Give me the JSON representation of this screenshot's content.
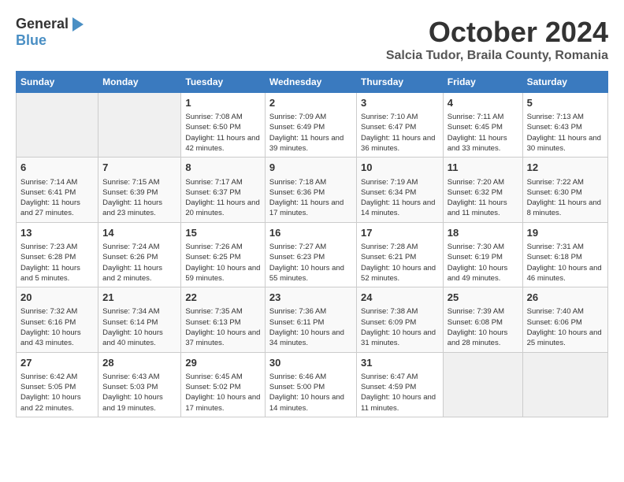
{
  "logo": {
    "general": "General",
    "blue": "Blue"
  },
  "title": "October 2024",
  "location": "Salcia Tudor, Braila County, Romania",
  "days_of_week": [
    "Sunday",
    "Monday",
    "Tuesday",
    "Wednesday",
    "Thursday",
    "Friday",
    "Saturday"
  ],
  "weeks": [
    [
      {
        "day": "",
        "empty": true
      },
      {
        "day": "",
        "empty": true
      },
      {
        "day": "1",
        "sunrise": "Sunrise: 7:08 AM",
        "sunset": "Sunset: 6:50 PM",
        "daylight": "Daylight: 11 hours and 42 minutes."
      },
      {
        "day": "2",
        "sunrise": "Sunrise: 7:09 AM",
        "sunset": "Sunset: 6:49 PM",
        "daylight": "Daylight: 11 hours and 39 minutes."
      },
      {
        "day": "3",
        "sunrise": "Sunrise: 7:10 AM",
        "sunset": "Sunset: 6:47 PM",
        "daylight": "Daylight: 11 hours and 36 minutes."
      },
      {
        "day": "4",
        "sunrise": "Sunrise: 7:11 AM",
        "sunset": "Sunset: 6:45 PM",
        "daylight": "Daylight: 11 hours and 33 minutes."
      },
      {
        "day": "5",
        "sunrise": "Sunrise: 7:13 AM",
        "sunset": "Sunset: 6:43 PM",
        "daylight": "Daylight: 11 hours and 30 minutes."
      }
    ],
    [
      {
        "day": "6",
        "sunrise": "Sunrise: 7:14 AM",
        "sunset": "Sunset: 6:41 PM",
        "daylight": "Daylight: 11 hours and 27 minutes."
      },
      {
        "day": "7",
        "sunrise": "Sunrise: 7:15 AM",
        "sunset": "Sunset: 6:39 PM",
        "daylight": "Daylight: 11 hours and 23 minutes."
      },
      {
        "day": "8",
        "sunrise": "Sunrise: 7:17 AM",
        "sunset": "Sunset: 6:37 PM",
        "daylight": "Daylight: 11 hours and 20 minutes."
      },
      {
        "day": "9",
        "sunrise": "Sunrise: 7:18 AM",
        "sunset": "Sunset: 6:36 PM",
        "daylight": "Daylight: 11 hours and 17 minutes."
      },
      {
        "day": "10",
        "sunrise": "Sunrise: 7:19 AM",
        "sunset": "Sunset: 6:34 PM",
        "daylight": "Daylight: 11 hours and 14 minutes."
      },
      {
        "day": "11",
        "sunrise": "Sunrise: 7:20 AM",
        "sunset": "Sunset: 6:32 PM",
        "daylight": "Daylight: 11 hours and 11 minutes."
      },
      {
        "day": "12",
        "sunrise": "Sunrise: 7:22 AM",
        "sunset": "Sunset: 6:30 PM",
        "daylight": "Daylight: 11 hours and 8 minutes."
      }
    ],
    [
      {
        "day": "13",
        "sunrise": "Sunrise: 7:23 AM",
        "sunset": "Sunset: 6:28 PM",
        "daylight": "Daylight: 11 hours and 5 minutes."
      },
      {
        "day": "14",
        "sunrise": "Sunrise: 7:24 AM",
        "sunset": "Sunset: 6:26 PM",
        "daylight": "Daylight: 11 hours and 2 minutes."
      },
      {
        "day": "15",
        "sunrise": "Sunrise: 7:26 AM",
        "sunset": "Sunset: 6:25 PM",
        "daylight": "Daylight: 10 hours and 59 minutes."
      },
      {
        "day": "16",
        "sunrise": "Sunrise: 7:27 AM",
        "sunset": "Sunset: 6:23 PM",
        "daylight": "Daylight: 10 hours and 55 minutes."
      },
      {
        "day": "17",
        "sunrise": "Sunrise: 7:28 AM",
        "sunset": "Sunset: 6:21 PM",
        "daylight": "Daylight: 10 hours and 52 minutes."
      },
      {
        "day": "18",
        "sunrise": "Sunrise: 7:30 AM",
        "sunset": "Sunset: 6:19 PM",
        "daylight": "Daylight: 10 hours and 49 minutes."
      },
      {
        "day": "19",
        "sunrise": "Sunrise: 7:31 AM",
        "sunset": "Sunset: 6:18 PM",
        "daylight": "Daylight: 10 hours and 46 minutes."
      }
    ],
    [
      {
        "day": "20",
        "sunrise": "Sunrise: 7:32 AM",
        "sunset": "Sunset: 6:16 PM",
        "daylight": "Daylight: 10 hours and 43 minutes."
      },
      {
        "day": "21",
        "sunrise": "Sunrise: 7:34 AM",
        "sunset": "Sunset: 6:14 PM",
        "daylight": "Daylight: 10 hours and 40 minutes."
      },
      {
        "day": "22",
        "sunrise": "Sunrise: 7:35 AM",
        "sunset": "Sunset: 6:13 PM",
        "daylight": "Daylight: 10 hours and 37 minutes."
      },
      {
        "day": "23",
        "sunrise": "Sunrise: 7:36 AM",
        "sunset": "Sunset: 6:11 PM",
        "daylight": "Daylight: 10 hours and 34 minutes."
      },
      {
        "day": "24",
        "sunrise": "Sunrise: 7:38 AM",
        "sunset": "Sunset: 6:09 PM",
        "daylight": "Daylight: 10 hours and 31 minutes."
      },
      {
        "day": "25",
        "sunrise": "Sunrise: 7:39 AM",
        "sunset": "Sunset: 6:08 PM",
        "daylight": "Daylight: 10 hours and 28 minutes."
      },
      {
        "day": "26",
        "sunrise": "Sunrise: 7:40 AM",
        "sunset": "Sunset: 6:06 PM",
        "daylight": "Daylight: 10 hours and 25 minutes."
      }
    ],
    [
      {
        "day": "27",
        "sunrise": "Sunrise: 6:42 AM",
        "sunset": "Sunset: 5:05 PM",
        "daylight": "Daylight: 10 hours and 22 minutes."
      },
      {
        "day": "28",
        "sunrise": "Sunrise: 6:43 AM",
        "sunset": "Sunset: 5:03 PM",
        "daylight": "Daylight: 10 hours and 19 minutes."
      },
      {
        "day": "29",
        "sunrise": "Sunrise: 6:45 AM",
        "sunset": "Sunset: 5:02 PM",
        "daylight": "Daylight: 10 hours and 17 minutes."
      },
      {
        "day": "30",
        "sunrise": "Sunrise: 6:46 AM",
        "sunset": "Sunset: 5:00 PM",
        "daylight": "Daylight: 10 hours and 14 minutes."
      },
      {
        "day": "31",
        "sunrise": "Sunrise: 6:47 AM",
        "sunset": "Sunset: 4:59 PM",
        "daylight": "Daylight: 10 hours and 11 minutes."
      },
      {
        "day": "",
        "empty": true
      },
      {
        "day": "",
        "empty": true
      }
    ]
  ]
}
